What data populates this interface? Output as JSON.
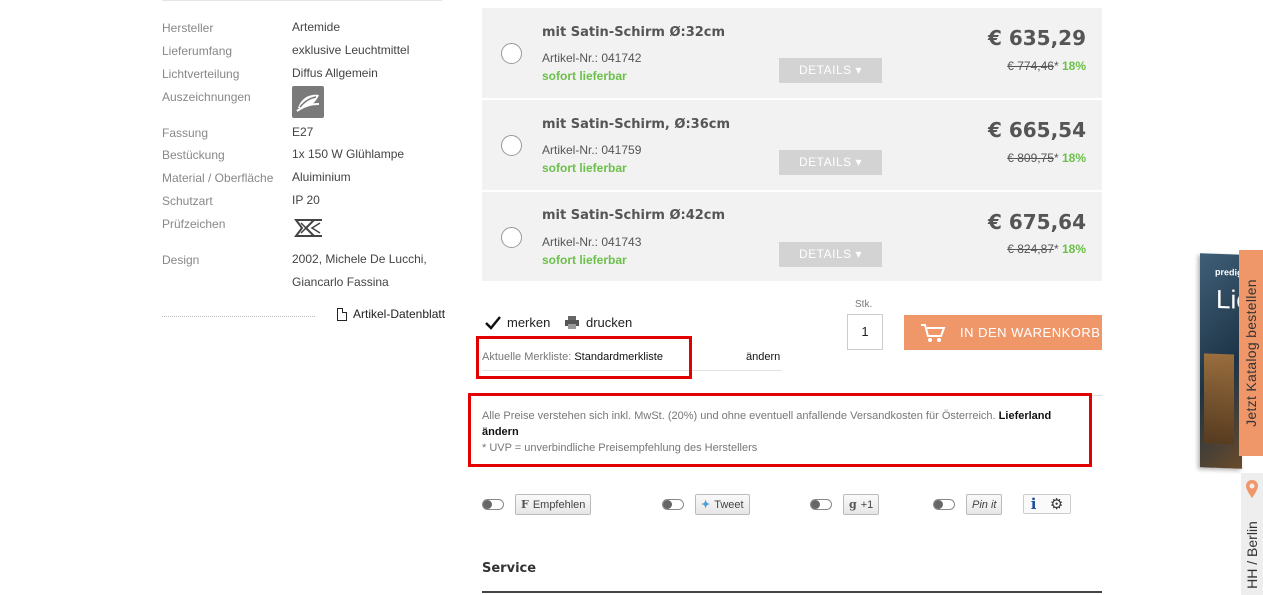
{
  "specs": [
    {
      "label": "Hersteller",
      "value": "Artemide"
    },
    {
      "label": "Lieferumfang",
      "value": "exklusive Leuchtmittel"
    },
    {
      "label": "Lichtverteilung",
      "value": "Diffus Allgemein"
    },
    {
      "label": "Auszeichnungen",
      "value": "",
      "icon": "eco-leaf-icon"
    },
    {
      "label": "Fassung",
      "value": "E27"
    },
    {
      "label": "Bestückung",
      "value": "1x 150 W Glühlampe"
    },
    {
      "label": "Material / Oberfläche",
      "value": "Aluiminium"
    },
    {
      "label": "Schutzart",
      "value": "IP 20"
    },
    {
      "label": "Prüfzeichen",
      "value": "",
      "icon": "ce-mark-icon"
    },
    {
      "label": "Design",
      "value": "2002, Michele De Lucchi,",
      "value2": "Giancarlo Fassina"
    }
  ],
  "datasheet_label": "Artikel-Datenblatt",
  "variants": [
    {
      "name": "mit Satin-Schirm Ø:32cm",
      "article": "Artikel-Nr.: 041742",
      "stock": "sofort lieferbar",
      "details": "DETAILS",
      "price": "€ 635,29",
      "uvp_old": "€ 774,46",
      "uvp_star": "*",
      "discount": "18%"
    },
    {
      "name": "mit Satin-Schirm, Ø:36cm",
      "article": "Artikel-Nr.: 041759",
      "stock": "sofort lieferbar",
      "details": "DETAILS",
      "price": "€ 665,54",
      "uvp_old": "€ 809,75",
      "uvp_star": "*",
      "discount": "18%"
    },
    {
      "name": "mit Satin-Schirm Ø:42cm",
      "article": "Artikel-Nr.: 041743",
      "stock": "sofort lieferbar",
      "details": "DETAILS",
      "price": "€ 675,64",
      "uvp_old": "€ 824,87",
      "uvp_star": "*",
      "discount": "18%"
    }
  ],
  "actions": {
    "merken": "merken",
    "drucken": "drucken",
    "merkliste_prefix": "Aktuelle Merkliste:",
    "merkliste_name": "Standardmerkliste",
    "aendern": "ändern"
  },
  "cart": {
    "qty_label": "Stk.",
    "qty_value": "1",
    "button_label": "IN DEN WARENKORB"
  },
  "info": {
    "line1": "Alle Preise verstehen sich inkl. MwSt. (20%) und ohne eventuell anfallende Versandkosten für Österreich.",
    "link": "Lieferland ändern",
    "line2": "* UVP = unverbindliche Preisempfehlung des Herstellers"
  },
  "social": {
    "facebook": "Empfehlen",
    "twitter": "Tweet",
    "google": "+1",
    "pinterest": "Pin it"
  },
  "service_heading": "Service",
  "side": {
    "catalog_tab": "Jetzt Katalog bestellen",
    "catalog_cover_brand": "predig",
    "catalog_cover_title": "Lic",
    "location_tab": "HH / Berlin"
  },
  "colors": {
    "accent_orange": "#f0976a",
    "stock_green": "#6cc04a",
    "highlight_red": "#e20000"
  }
}
